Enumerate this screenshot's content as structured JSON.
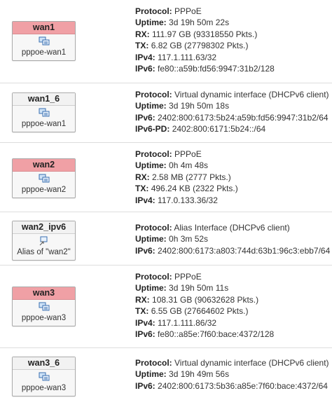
{
  "interfaces": [
    {
      "name": "wan1",
      "device": "pppoe-wan1",
      "status_color": "#f0a0a5",
      "protocol_label": "Protocol:",
      "protocol": "PPPoE",
      "uptime_label": "Uptime:",
      "uptime": "3d 19h 50m 22s",
      "rx_label": "RX:",
      "rx": "111.97 GB (93318550 Pkts.)",
      "tx_label": "TX:",
      "tx": "6.82 GB (27798302 Pkts.)",
      "ipv4_label": "IPv4:",
      "ipv4": "117.1.111.63/32",
      "ipv6_label": "IPv6:",
      "ipv6": "fe80::a59b:fd56:9947:31b2/128"
    },
    {
      "name": "wan1_6",
      "device": "pppoe-wan1",
      "protocol_label": "Protocol:",
      "protocol": "Virtual dynamic interface (DHCPv6 client)",
      "uptime_label": "Uptime:",
      "uptime": "3d 19h 50m 18s",
      "ipv6_label": "IPv6:",
      "ipv6": "2402:800:6173:5b24:a59b:fd56:9947:31b2/64",
      "ipv6pd_label": "IPv6-PD:",
      "ipv6pd": "2402:800:6171:5b24::/64"
    },
    {
      "name": "wan2",
      "device": "pppoe-wan2",
      "status_color": "#f0a0a5",
      "protocol_label": "Protocol:",
      "protocol": "PPPoE",
      "uptime_label": "Uptime:",
      "uptime": "0h 4m 48s",
      "rx_label": "RX:",
      "rx": "2.58 MB (2777 Pkts.)",
      "tx_label": "TX:",
      "tx": "496.24 KB (2322 Pkts.)",
      "ipv4_label": "IPv4:",
      "ipv4": "117.0.133.36/32"
    },
    {
      "name": "wan2_ipv6",
      "device": "Alias of \"wan2\"",
      "protocol_label": "Protocol:",
      "protocol": "Alias Interface (DHCPv6 client)",
      "uptime_label": "Uptime:",
      "uptime": "0h 3m 52s",
      "ipv6_label": "IPv6:",
      "ipv6": "2402:800:6173:a803:744d:63b1:96c3:ebb7/64"
    },
    {
      "name": "wan3",
      "device": "pppoe-wan3",
      "status_color": "#f0a0a5",
      "protocol_label": "Protocol:",
      "protocol": "PPPoE",
      "uptime_label": "Uptime:",
      "uptime": "3d 19h 50m 11s",
      "rx_label": "RX:",
      "rx": "108.31 GB (90632628 Pkts.)",
      "tx_label": "TX:",
      "tx": "6.55 GB (27664602 Pkts.)",
      "ipv4_label": "IPv4:",
      "ipv4": "117.1.111.86/32",
      "ipv6_label": "IPv6:",
      "ipv6": "fe80::a85e:7f60:bace:4372/128"
    },
    {
      "name": "wan3_6",
      "device": "pppoe-wan3",
      "protocol_label": "Protocol:",
      "protocol": "Virtual dynamic interface (DHCPv6 client)",
      "uptime_label": "Uptime:",
      "uptime": "3d 19h 49m 56s",
      "ipv6_label": "IPv6:",
      "ipv6": "2402:800:6173:5b36:a85e:7f60:bace:4372/64"
    }
  ]
}
